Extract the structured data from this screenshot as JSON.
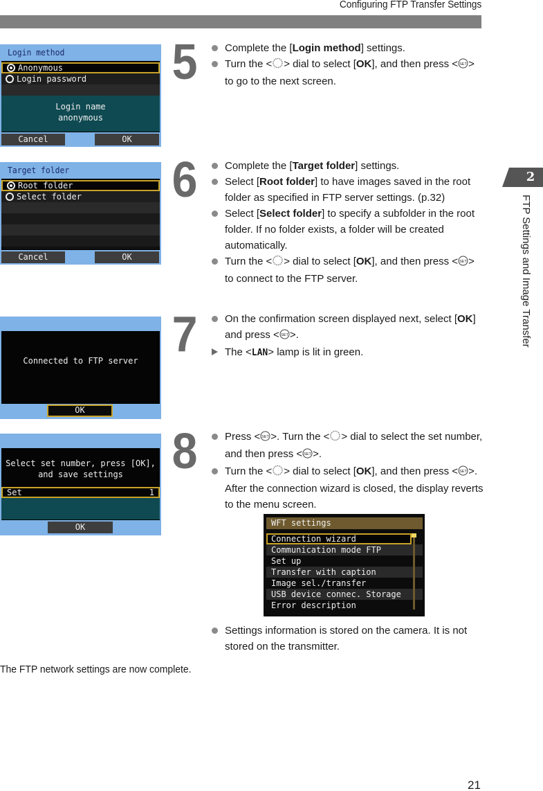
{
  "header": {
    "title": "Configuring FTP Transfer Settings"
  },
  "chapter": {
    "number": "2",
    "label": "FTP Settings and Image Transfer",
    "tab_color": "#555555"
  },
  "icons": {
    "dial": "quick-control-dial-icon",
    "set": "set-button-icon",
    "bullet": "bullet-dot",
    "result": "result-triangle"
  },
  "steps": [
    {
      "number": "5",
      "bullets": [
        {
          "type": "dot",
          "parts": [
            "Complete the [",
            "Login method",
            "] settings."
          ]
        },
        {
          "type": "dot",
          "parts": [
            "Turn the <",
            "dial",
            "> dial to select [",
            "OK",
            "], and then press <",
            "SET",
            "> to go to the next screen."
          ]
        }
      ],
      "screen": {
        "title": "Login method",
        "options": [
          {
            "label": "Anonymous",
            "selected": true
          },
          {
            "label": "Login password",
            "selected": false
          }
        ],
        "info_lines": [
          "Login name",
          "anonymous"
        ],
        "buttons": [
          "Cancel",
          "OK"
        ]
      }
    },
    {
      "number": "6",
      "bullets": [
        {
          "type": "dot",
          "parts": [
            "Complete the [",
            "Target folder",
            "] settings."
          ]
        },
        {
          "type": "dot",
          "parts": [
            "Select [",
            "Root folder",
            "] to have images saved in the root folder as specified in FTP server settings. (p.32)"
          ]
        },
        {
          "type": "dot",
          "parts": [
            "Select [",
            "Select folder",
            "] to specify a subfolder in the root folder. If no folder exists, a folder will be created automatically."
          ]
        },
        {
          "type": "dot",
          "parts": [
            "Turn the <",
            "dial",
            "> dial to select [",
            "OK",
            "], and then press <",
            "SET",
            "> to connect to the FTP server."
          ]
        }
      ],
      "screen": {
        "title": "Target folder",
        "options": [
          {
            "label": "Root folder",
            "selected": true
          },
          {
            "label": "Select folder",
            "selected": false
          }
        ],
        "buttons": [
          "Cancel",
          "OK"
        ]
      }
    },
    {
      "number": "7",
      "bullets": [
        {
          "type": "dot",
          "parts": [
            "On the confirmation screen displayed next, select [",
            "OK",
            "] and press <",
            "SET",
            ">."
          ]
        },
        {
          "type": "result",
          "parts": [
            "The <",
            "LAN",
            "> lamp is lit in green."
          ]
        }
      ],
      "screen": {
        "message": "Connected to FTP server",
        "button": "OK"
      }
    },
    {
      "number": "8",
      "bullets": [
        {
          "type": "dot",
          "parts": [
            "Press <",
            "SET",
            ">. Turn the <",
            "dial",
            "> dial to select the set number, and then press <",
            "SET",
            ">."
          ]
        },
        {
          "type": "dot",
          "parts": [
            "Turn the <",
            "dial",
            "> dial to select [",
            "OK",
            "], and then press <",
            "SET",
            ">. After the connection wizard is closed, the display reverts to the menu screen."
          ]
        },
        {
          "type": "dot",
          "parts": [
            "Settings information is stored on the camera. It is not stored on the transmitter."
          ]
        }
      ],
      "screen": {
        "message_lines": [
          "Select set number, press [OK],",
          "and save settings"
        ],
        "field_label": "Set",
        "field_value": "1",
        "button": "OK"
      },
      "menu_screen": {
        "title": "WFT settings",
        "items": [
          {
            "label": "Connection wizard",
            "selected": true
          },
          {
            "label": "Communication mode FTP",
            "selected": false
          },
          {
            "label": "Set up",
            "selected": false
          },
          {
            "label": "Transfer with caption",
            "selected": false
          },
          {
            "label": "Image sel./transfer",
            "selected": false
          },
          {
            "label": "USB device connec. Storage",
            "selected": false
          },
          {
            "label": "Error description",
            "selected": false
          }
        ]
      }
    }
  ],
  "footer": {
    "text": "The FTP network settings are now complete.",
    "page_number": "21"
  },
  "colors": {
    "lcd_bg": "#7fb2e6",
    "lcd_panel": "#101010",
    "lcd_teal": "#0f4a52",
    "lcd_highlight": "#c9a227",
    "menu_title": "#6e5a2e",
    "header_bar": "#808080",
    "step_number": "#6a6a6a"
  }
}
